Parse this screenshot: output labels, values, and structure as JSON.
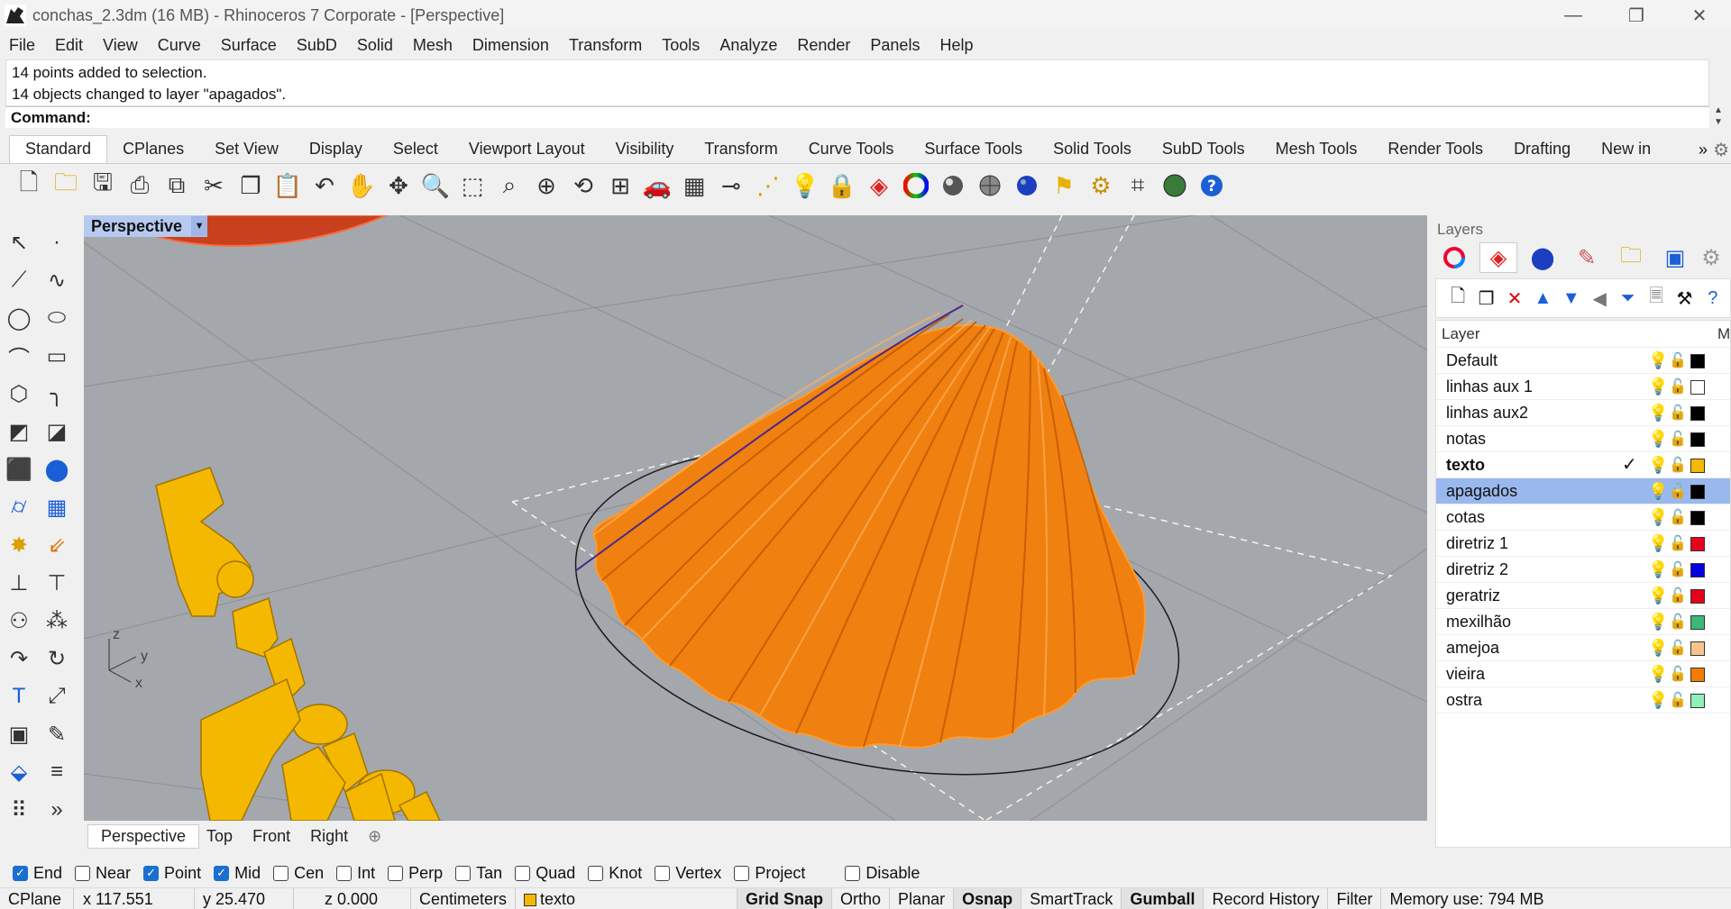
{
  "window": {
    "title": "conchas_2.3dm (16 MB) - Rhinoceros 7 Corporate - [Perspective]",
    "minimize_glyph": "—",
    "restore_glyph": "❐",
    "close_glyph": "✕"
  },
  "menu": [
    "File",
    "Edit",
    "View",
    "Curve",
    "Surface",
    "SubD",
    "Solid",
    "Mesh",
    "Dimension",
    "Transform",
    "Tools",
    "Analyze",
    "Render",
    "Panels",
    "Help"
  ],
  "history": [
    "14 points added to selection.",
    "14 objects changed to layer \"apagados\"."
  ],
  "command": {
    "prompt": "Command:"
  },
  "toolbar_tabs": [
    "Standard",
    "CPlanes",
    "Set View",
    "Display",
    "Select",
    "Viewport Layout",
    "Visibility",
    "Transform",
    "Curve Tools",
    "Surface Tools",
    "Solid Tools",
    "SubD Tools",
    "Mesh Tools",
    "Render Tools",
    "Drafting",
    "New in"
  ],
  "toolbar_more": "»",
  "toolbar_icons": [
    "new-file-icon",
    "open-icon",
    "save-icon",
    "print-icon",
    "import-icon",
    "cut-icon",
    "copy-icon",
    "paste-icon",
    "undo-icon",
    "pan-icon",
    "rotate-view-icon",
    "zoom-icon",
    "zoom-window-icon",
    "zoom-extents-icon",
    "zoom-selected-icon",
    "rotate-icon",
    "four-viewports-icon",
    "car-icon",
    "grid-icon",
    "cplane-icon",
    "snap-icon",
    "bulb-icon",
    "lock-icon",
    "layer-icon",
    "color-wheel-icon",
    "shade-icon",
    "render-sphere-icon",
    "blue-sphere-icon",
    "light-icon",
    "options-gear-icon",
    "gumball-icon",
    "globe-icon",
    "help-icon"
  ],
  "viewport": {
    "name": "Perspective",
    "tabs": [
      "Perspective",
      "Top",
      "Front",
      "Right"
    ],
    "axis_z": "z",
    "axis_y": "y",
    "axis_x": "x"
  },
  "layers_panel": {
    "title": "Layers",
    "header": {
      "layer": "Layer",
      "material_col": "M"
    },
    "layers": [
      {
        "name": "Default",
        "color": "#000000",
        "current": false,
        "selected": false
      },
      {
        "name": "linhas aux 1",
        "color": "#ffffff",
        "current": false,
        "selected": false
      },
      {
        "name": "linhas aux2",
        "color": "#000000",
        "current": false,
        "selected": false
      },
      {
        "name": "notas",
        "color": "#000000",
        "current": false,
        "selected": false
      },
      {
        "name": "texto",
        "color": "#f5b800",
        "current": true,
        "selected": false
      },
      {
        "name": "apagados",
        "color": "#000000",
        "current": false,
        "selected": true
      },
      {
        "name": "cotas",
        "color": "#000000",
        "current": false,
        "selected": false
      },
      {
        "name": "diretriz 1",
        "color": "#e8001c",
        "current": false,
        "selected": false
      },
      {
        "name": "diretriz 2",
        "color": "#0000e0",
        "current": false,
        "selected": false
      },
      {
        "name": "geratriz",
        "color": "#e8001c",
        "current": false,
        "selected": false
      },
      {
        "name": "mexilhão",
        "color": "#3cb878",
        "current": false,
        "selected": false
      },
      {
        "name": "amejoa",
        "color": "#f7c58a",
        "current": false,
        "selected": false
      },
      {
        "name": "vieira",
        "color": "#f57c00",
        "current": false,
        "selected": false
      },
      {
        "name": "ostra",
        "color": "#8ff0b8",
        "current": false,
        "selected": false
      }
    ]
  },
  "osnaps": [
    {
      "label": "End",
      "checked": true
    },
    {
      "label": "Near",
      "checked": false
    },
    {
      "label": "Point",
      "checked": true
    },
    {
      "label": "Mid",
      "checked": true
    },
    {
      "label": "Cen",
      "checked": false
    },
    {
      "label": "Int",
      "checked": false
    },
    {
      "label": "Perp",
      "checked": false
    },
    {
      "label": "Tan",
      "checked": false
    },
    {
      "label": "Quad",
      "checked": false
    },
    {
      "label": "Knot",
      "checked": false
    },
    {
      "label": "Vertex",
      "checked": false
    },
    {
      "label": "Project",
      "checked": false
    },
    {
      "label": "Disable",
      "checked": false
    }
  ],
  "status": {
    "cplane": "CPlane",
    "x": "x 117.551",
    "y": "y 25.470",
    "z": "z 0.000",
    "units": "Centimeters",
    "layer": "texto",
    "grid_snap": "Grid Snap",
    "ortho": "Ortho",
    "planar": "Planar",
    "osnap": "Osnap",
    "smarttrack": "SmartTrack",
    "gumball": "Gumball",
    "record_history": "Record History",
    "filter": "Filter",
    "memory": "Memory use: 794 MB"
  }
}
